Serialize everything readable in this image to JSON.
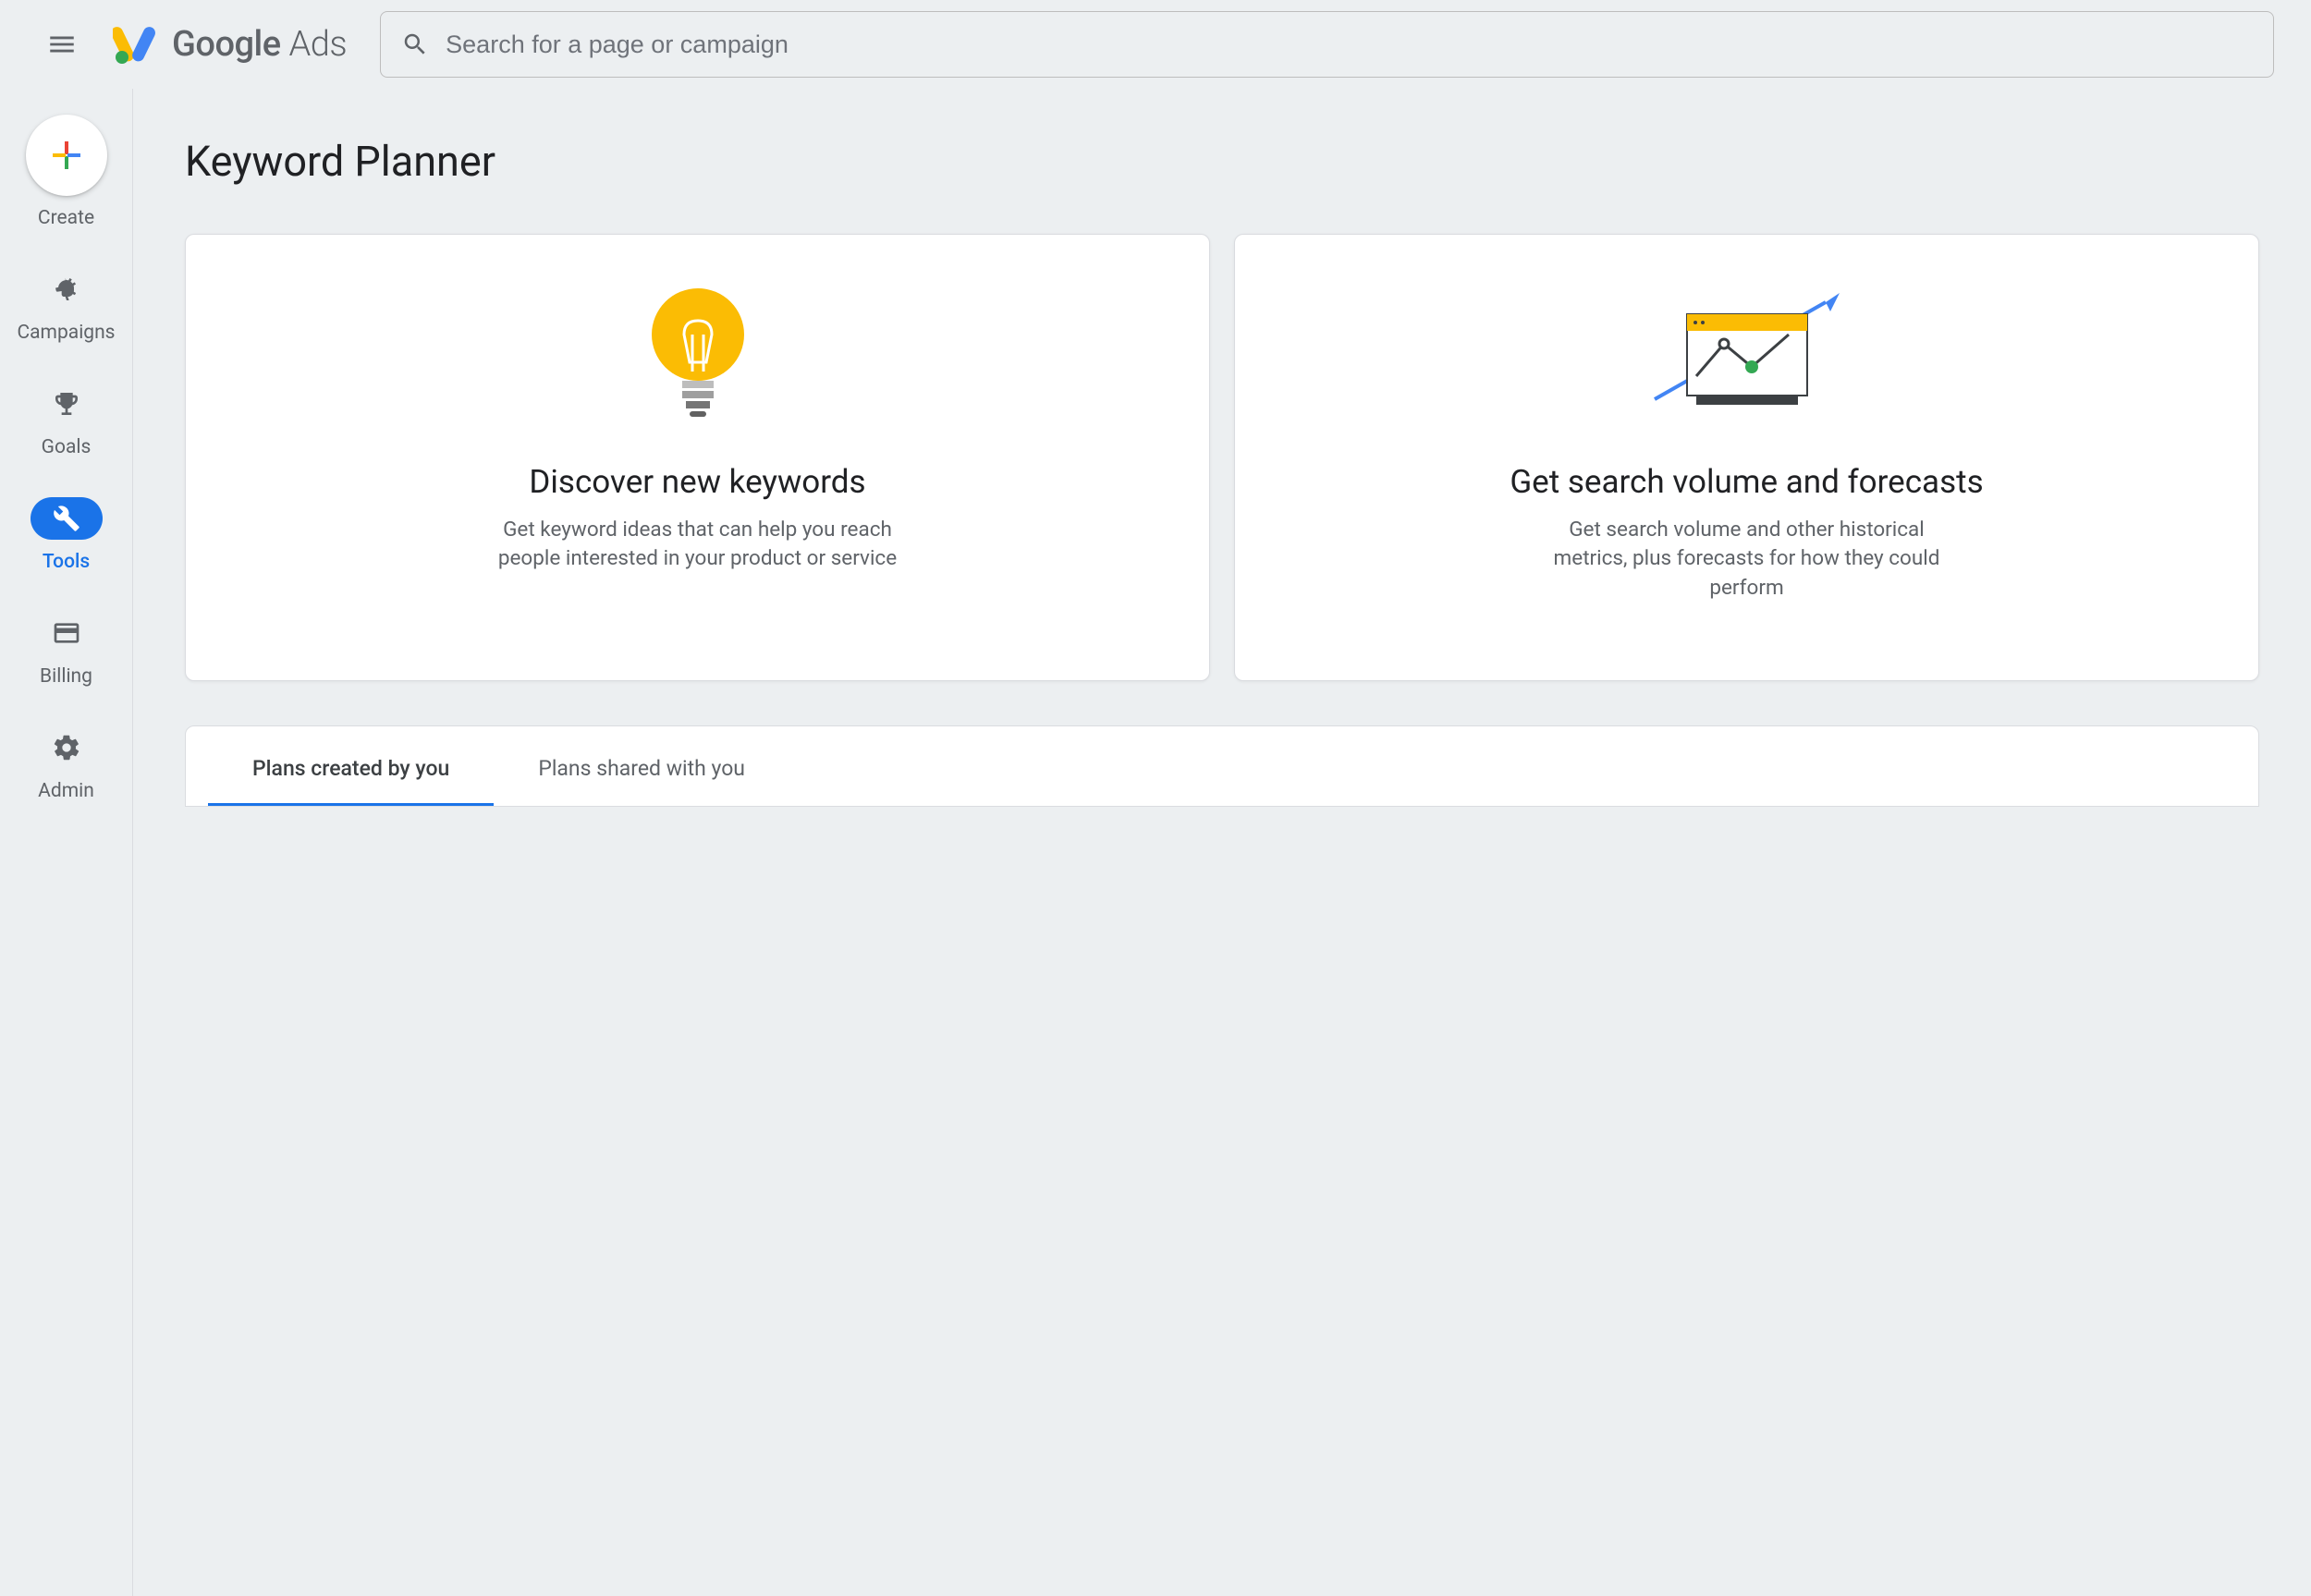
{
  "header": {
    "logo_primary": "Google",
    "logo_secondary": "Ads",
    "search_placeholder": "Search for a page or campaign"
  },
  "sidebar": {
    "items": [
      {
        "id": "create",
        "label": "Create",
        "active": false
      },
      {
        "id": "campaigns",
        "label": "Campaigns",
        "active": false
      },
      {
        "id": "goals",
        "label": "Goals",
        "active": false
      },
      {
        "id": "tools",
        "label": "Tools",
        "active": true
      },
      {
        "id": "billing",
        "label": "Billing",
        "active": false
      },
      {
        "id": "admin",
        "label": "Admin",
        "active": false
      }
    ]
  },
  "main": {
    "page_title": "Keyword Planner",
    "cards": [
      {
        "title": "Discover new keywords",
        "desc": "Get keyword ideas that can help you reach people interested in your product or service"
      },
      {
        "title": "Get search volume and forecasts",
        "desc": "Get search volume and other historical metrics, plus forecasts for how they could perform"
      }
    ],
    "tabs": [
      {
        "label": "Plans created by you",
        "active": true
      },
      {
        "label": "Plans shared with you",
        "active": false
      }
    ]
  },
  "colors": {
    "accent": "#1a73e8",
    "google_blue": "#4285f4",
    "google_red": "#ea4335",
    "google_yellow": "#fbbc04",
    "google_green": "#34a853"
  }
}
